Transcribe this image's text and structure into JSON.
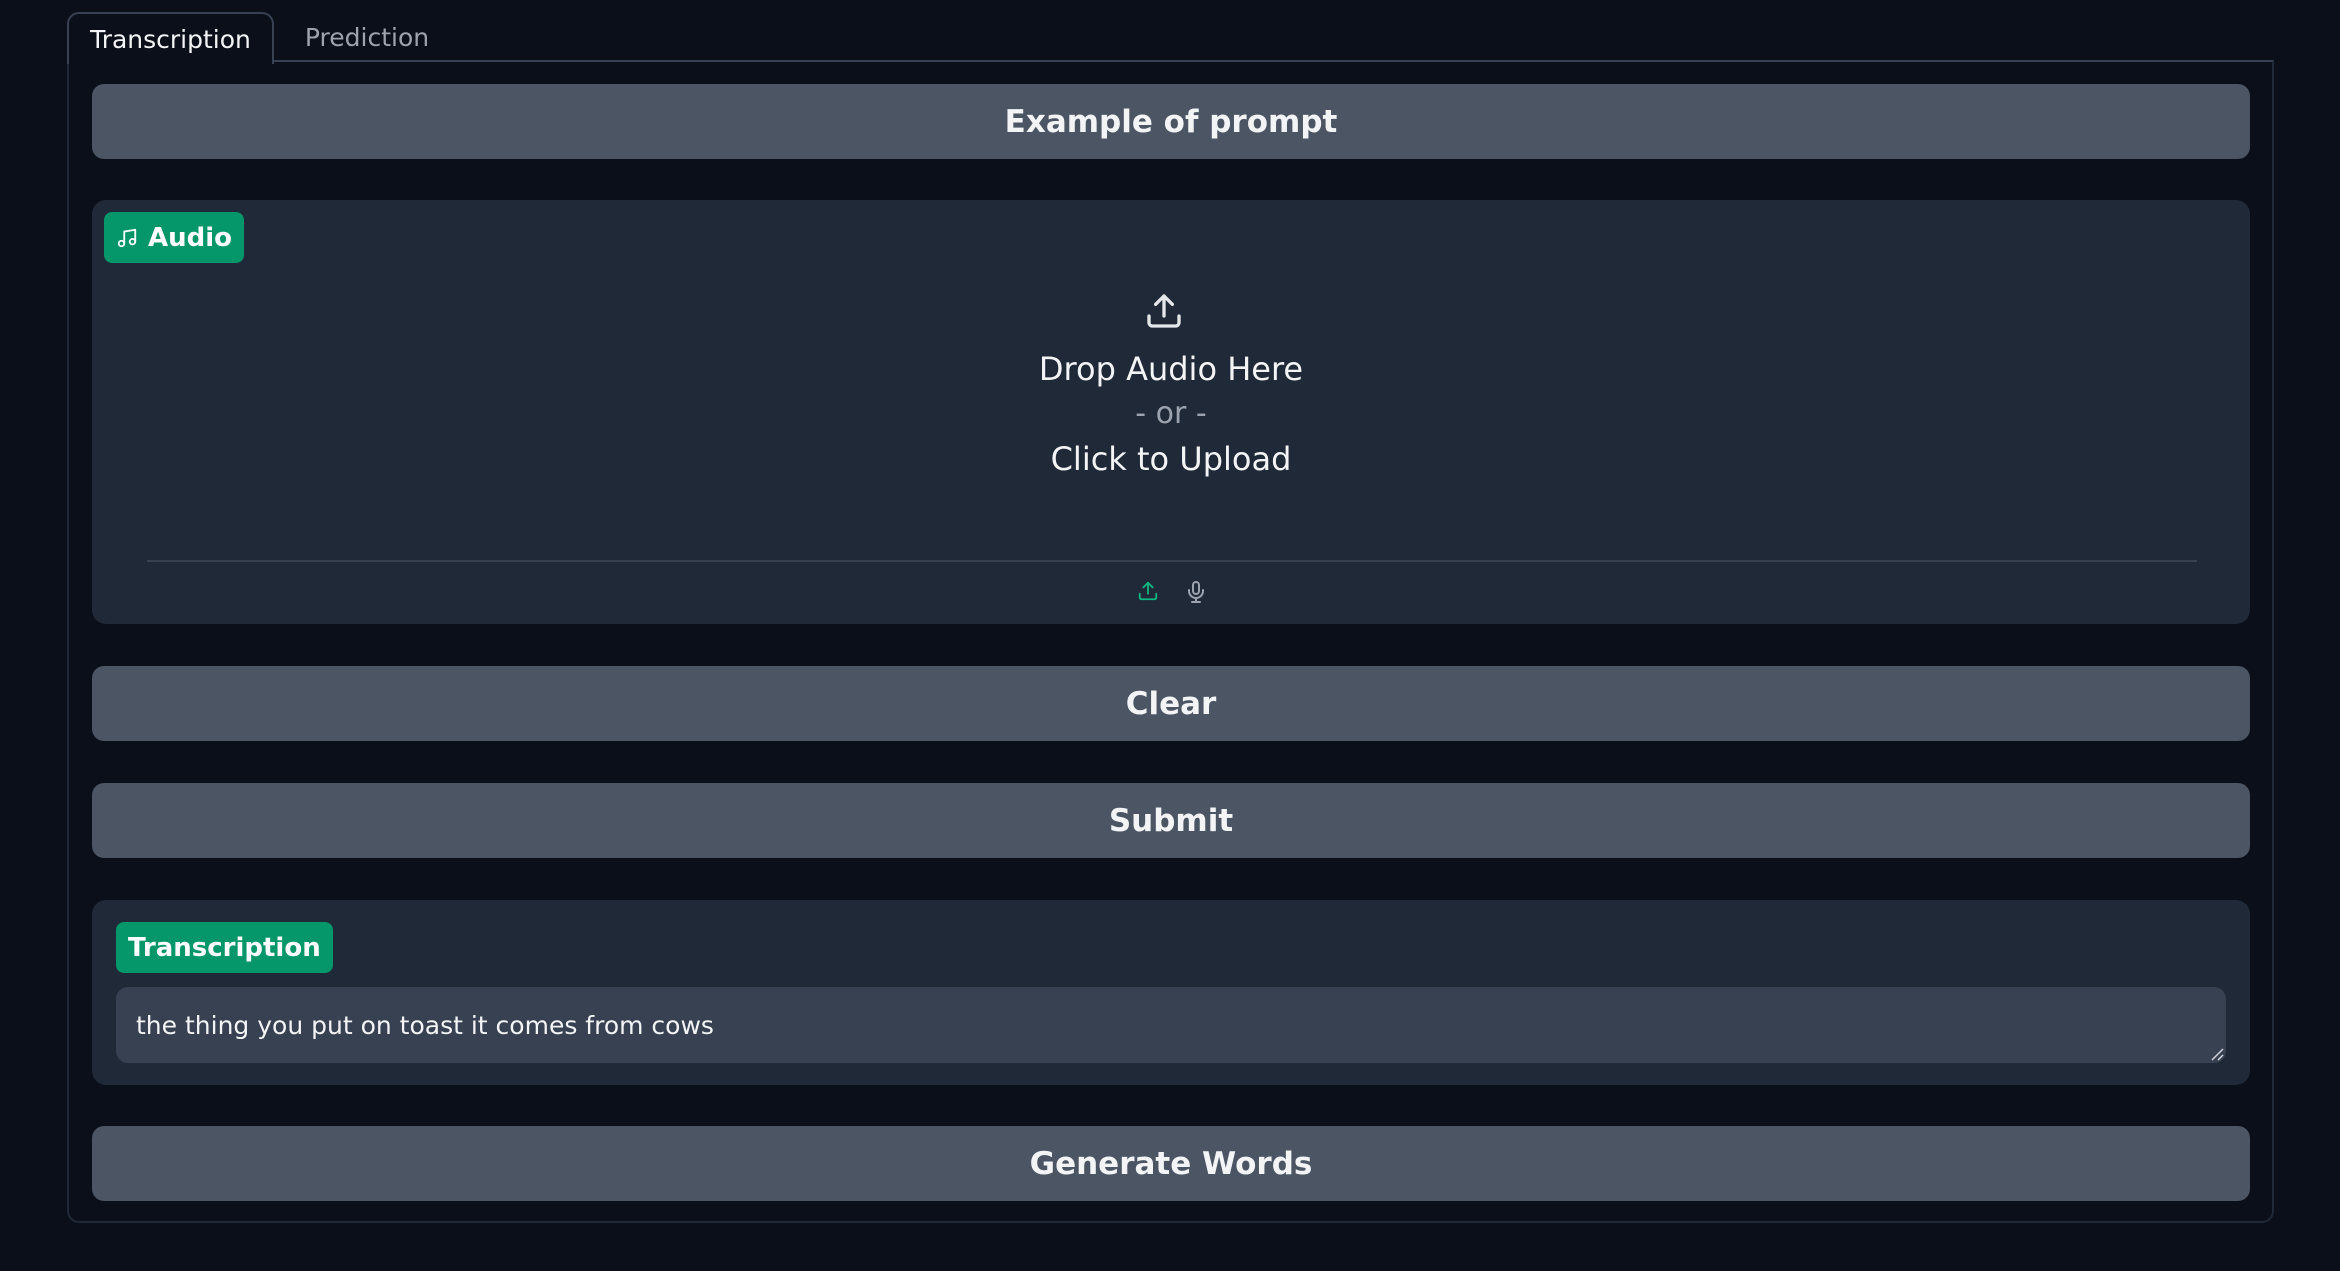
{
  "tabs": [
    {
      "label": "Transcription",
      "active": true
    },
    {
      "label": "Prediction",
      "active": false
    }
  ],
  "buttons": {
    "example": "Example of prompt",
    "clear": "Clear",
    "submit": "Submit",
    "generate": "Generate Words"
  },
  "audio": {
    "label": "Audio",
    "icon": "music-note-icon",
    "drop_text": "Drop Audio Here",
    "or_text": "- or -",
    "click_text": "Click to Upload",
    "sources": [
      "upload-icon",
      "microphone-icon"
    ]
  },
  "transcription": {
    "label": "Transcription",
    "value": "the thing you put on toast it comes from cows"
  },
  "colors": {
    "background": "#0b0f19",
    "button": "#4b5563",
    "block": "#1f2937",
    "accent": "#059669"
  }
}
